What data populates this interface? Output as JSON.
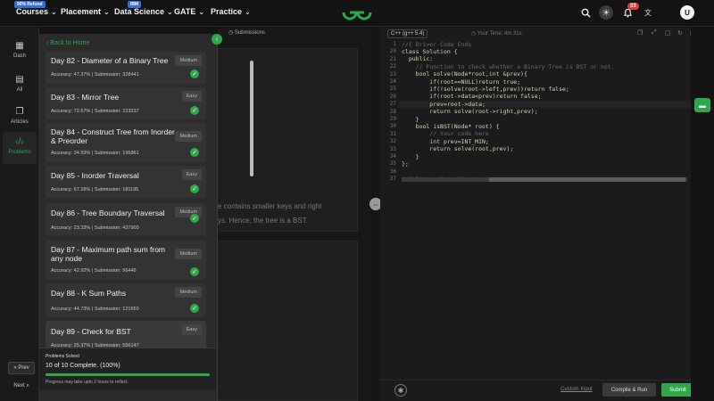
{
  "nav": {
    "courses_badge": "90% Refund",
    "courses": "Courses",
    "placement": "Placement",
    "datascience_badge": "IBM",
    "datascience": "Data Science",
    "gate": "GATE",
    "practice": "Practice",
    "notifications": "33",
    "avatar": "U"
  },
  "rail": {
    "dash": "Dash",
    "all": "All",
    "articles": "Articles",
    "problems": "Problems",
    "prev": "« Prev",
    "next": "Next »"
  },
  "panel": {
    "back": "‹ Back to Home",
    "problems": [
      {
        "title": "Day 82 - Diameter of a Binary Tree",
        "difficulty": "Medium",
        "stats": "Accuracy: 47.37% | Submission: 328441"
      },
      {
        "title": "Day 83 - Mirror Tree",
        "difficulty": "Easy",
        "stats": "Accuracy: 72.67% | Submission: 223237"
      },
      {
        "title": "Day 84 - Construct Tree from Inorder & Preorder",
        "difficulty": "Medium",
        "stats": "Accuracy: 34.59% | Submission: 195861"
      },
      {
        "title": "Day 85 - Inorder Traversal",
        "difficulty": "Easy",
        "stats": "Accuracy: 67.16% | Submission: 181195"
      },
      {
        "title": "Day 86 - Tree Boundary Traversal",
        "difficulty": "Medium",
        "stats": "Accuracy: 23.33% | Submission: 437900"
      },
      {
        "title": "Day 87 - Maximum path sum from any node",
        "difficulty": "Medium",
        "stats": "Accuracy: 42.92% | Submission: 96446"
      },
      {
        "title": "Day 88 - K Sum Paths",
        "difficulty": "Medium",
        "stats": "Accuracy: 44.73% | Submission: 121650"
      },
      {
        "title": "Day 89 - Check for BST",
        "difficulty": "Easy",
        "stats": "Accuracy: 25.37% | Submission: 556147"
      }
    ],
    "summary_title": "Problems Solved",
    "summary_count": "10 of 10 Complete. (100%)",
    "summary_progress": 1.0,
    "summary_note": "Progress may take upto 2 hours to reflect."
  },
  "middle": {
    "submissions_tab": "Submissions",
    "explain_line1": "e contains smaller keys and right",
    "explain_line2": "ys. Hence, the tree is a BST."
  },
  "editor": {
    "language": "C++ (g++ 5.4)",
    "timer": "Your Time: 4m 31s",
    "lines": [
      {
        "n": "1",
        "code": "//{ Driver Code Ends"
      },
      {
        "n": "20",
        "code": "class Solution {"
      },
      {
        "n": "21",
        "code": "  public:"
      },
      {
        "n": "22",
        "code": "    // Function to check whether a Binary Tree is BST or not."
      },
      {
        "n": "23",
        "code": "    bool solve(Node*root,int &prev){"
      },
      {
        "n": "24",
        "code": "        if(root==NULL)return true;"
      },
      {
        "n": "25",
        "code": "        if(!solve(root->left,prev))return false;"
      },
      {
        "n": "26",
        "code": "        if(root->data<prev)return false;"
      },
      {
        "n": "27",
        "code": "        prev=root->data;"
      },
      {
        "n": "28",
        "code": "        return solve(root->right,prev);"
      },
      {
        "n": "29",
        "code": "    }"
      },
      {
        "n": "30",
        "code": "    bool isBST(Node* root) {"
      },
      {
        "n": "31",
        "code": "        // Your code here"
      },
      {
        "n": "32",
        "code": "        int prev=INT_MIN;"
      },
      {
        "n": "33",
        "code": "        return solve(root,prev);"
      },
      {
        "n": "34",
        "code": "    }"
      },
      {
        "n": "35",
        "code": "};"
      },
      {
        "n": "36",
        "code": ""
      },
      {
        "n": "37",
        "code": "//{ Driver Code Starts."
      }
    ],
    "custom_input": "Custom Input",
    "compile": "Compile & Run",
    "submit": "Submit"
  }
}
